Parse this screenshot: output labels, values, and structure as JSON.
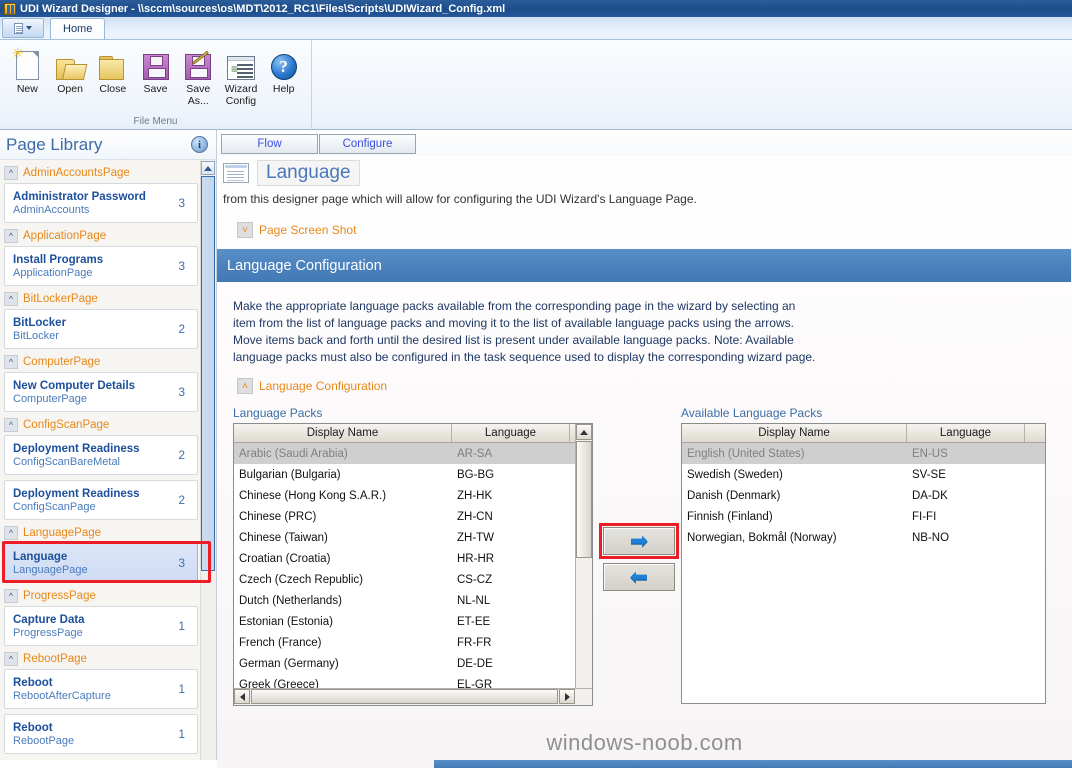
{
  "window": {
    "title": "UDI Wizard Designer - \\\\sccm\\sources\\os\\MDT\\2012_RC1\\Files\\Scripts\\UDIWizard_Config.xml",
    "app_icon": "udi-app-icon"
  },
  "ribbon": {
    "app_button": "file-menu-button",
    "tabs": [
      {
        "label": "Home",
        "active": true
      }
    ],
    "group": {
      "label": "File Menu",
      "items": [
        {
          "label": "New",
          "icon": "new-document-icon"
        },
        {
          "label": "Open",
          "icon": "open-folder-icon"
        },
        {
          "label": "Close",
          "icon": "closed-folder-icon"
        },
        {
          "label": "Save",
          "icon": "floppy-disk-icon"
        },
        {
          "label": "Save As...",
          "icon": "floppy-disk-pencil-icon"
        },
        {
          "label": "Wizard Config",
          "icon": "wizard-config-icon"
        },
        {
          "label": "Help",
          "icon": "help-question-icon"
        }
      ]
    }
  },
  "sidebar": {
    "title": "Page Library",
    "info_icon": "info-icon",
    "groups": [
      {
        "name": "AdminAccountsPage",
        "pages": [
          {
            "title": "Administrator Password",
            "subtitle": "AdminAccounts",
            "count": "3",
            "selected": false
          }
        ]
      },
      {
        "name": "ApplicationPage",
        "pages": [
          {
            "title": "Install Programs",
            "subtitle": "ApplicationPage",
            "count": "3",
            "selected": false
          }
        ]
      },
      {
        "name": "BitLockerPage",
        "pages": [
          {
            "title": "BitLocker",
            "subtitle": "BitLocker",
            "count": "2",
            "selected": false
          }
        ]
      },
      {
        "name": "ComputerPage",
        "pages": [
          {
            "title": "New Computer Details",
            "subtitle": "ComputerPage",
            "count": "3",
            "selected": false
          }
        ]
      },
      {
        "name": "ConfigScanPage",
        "pages": [
          {
            "title": "Deployment Readiness",
            "subtitle": "ConfigScanBareMetal",
            "count": "2",
            "selected": false
          },
          {
            "title": "Deployment Readiness",
            "subtitle": "ConfigScanPage",
            "count": "2",
            "selected": false
          }
        ]
      },
      {
        "name": "LanguagePage",
        "pages": [
          {
            "title": "Language",
            "subtitle": "LanguagePage",
            "count": "3",
            "selected": true
          }
        ]
      },
      {
        "name": "ProgressPage",
        "pages": [
          {
            "title": "Capture Data",
            "subtitle": "ProgressPage",
            "count": "1",
            "selected": false
          }
        ]
      },
      {
        "name": "RebootPage",
        "pages": [
          {
            "title": "Reboot",
            "subtitle": "RebootAfterCapture",
            "count": "1",
            "selected": false
          },
          {
            "title": "Reboot",
            "subtitle": "RebootPage",
            "count": "1",
            "selected": false
          }
        ]
      }
    ]
  },
  "main": {
    "tabs": [
      {
        "label": "Flow"
      },
      {
        "label": "Configure"
      }
    ],
    "page_title": "Language",
    "page_description": "from this designer page which will allow for configuring the UDI Wizard's Language Page.",
    "screenshot_section": {
      "label": "Page Screen Shot",
      "toggle": "˅"
    },
    "section_band_title": "Language Configuration",
    "body_text": "Make the appropriate language packs available from the corresponding page in the wizard by selecting an item from the list of language packs and moving it to the list of available language packs using the arrows. Move items back and forth until the desired list is present under available language packs. Note: Available language packs must also be configured in the task sequence used to display the corresponding wizard page.",
    "sub_section": {
      "label": "Language Configuration",
      "toggle": "˄"
    },
    "left_list": {
      "label": "Language Packs",
      "columns": [
        "Display Name",
        "Language"
      ],
      "rows": [
        {
          "display_name": "Arabic (Saudi Arabia)",
          "language": "AR-SA",
          "disabled": true
        },
        {
          "display_name": "Bulgarian (Bulgaria)",
          "language": "BG-BG",
          "disabled": false
        },
        {
          "display_name": "Chinese (Hong Kong S.A.R.)",
          "language": "ZH-HK",
          "disabled": false
        },
        {
          "display_name": "Chinese (PRC)",
          "language": "ZH-CN",
          "disabled": false
        },
        {
          "display_name": "Chinese (Taiwan)",
          "language": "ZH-TW",
          "disabled": false
        },
        {
          "display_name": "Croatian (Croatia)",
          "language": "HR-HR",
          "disabled": false
        },
        {
          "display_name": "Czech (Czech Republic)",
          "language": "CS-CZ",
          "disabled": false
        },
        {
          "display_name": "Dutch (Netherlands)",
          "language": "NL-NL",
          "disabled": false
        },
        {
          "display_name": "Estonian (Estonia)",
          "language": "ET-EE",
          "disabled": false
        },
        {
          "display_name": "French (France)",
          "language": "FR-FR",
          "disabled": false
        },
        {
          "display_name": "German (Germany)",
          "language": "DE-DE",
          "disabled": false
        },
        {
          "display_name": "Greek (Greece)",
          "language": "EL-GR",
          "disabled": false
        }
      ]
    },
    "right_list": {
      "label": "Available Language Packs",
      "columns": [
        "Display Name",
        "Language"
      ],
      "rows": [
        {
          "display_name": "English (United States)",
          "language": "EN-US",
          "disabled": true
        },
        {
          "display_name": "Swedish (Sweden)",
          "language": "SV-SE",
          "disabled": false
        },
        {
          "display_name": "Danish (Denmark)",
          "language": "DA-DK",
          "disabled": false
        },
        {
          "display_name": "Finnish (Finland)",
          "language": "FI-FI",
          "disabled": false
        },
        {
          "display_name": "Norwegian, Bokmål (Norway)",
          "language": "NB-NO",
          "disabled": false
        }
      ]
    },
    "buttons": {
      "move_right": {
        "icon": "arrow-right-icon",
        "glyph": "➡",
        "highlighted": true
      },
      "move_left": {
        "icon": "arrow-left-icon",
        "glyph": "⬅",
        "highlighted": false
      }
    }
  },
  "watermark": "windows-noob.com",
  "colors": {
    "titlebar": "#1d4d8a",
    "section_band": "#4b82bd",
    "accent_orange": "#e8881a",
    "link_blue": "#3a6ea8",
    "highlight_red": "#ee1c25",
    "arrow_blue": "#1d7fd6"
  }
}
